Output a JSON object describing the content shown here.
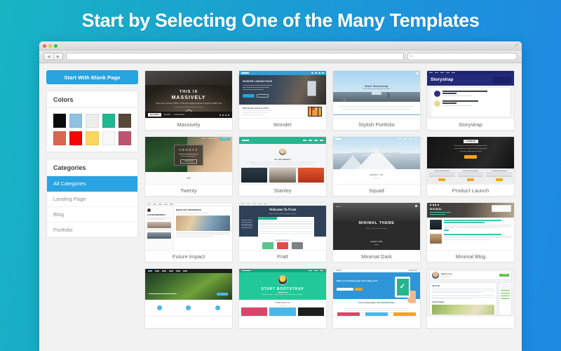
{
  "headline": "Start by Selecting One of the Many Templates",
  "browser": {
    "window_controls": [
      "close",
      "minimize",
      "maximize"
    ],
    "back_icon": "◀",
    "forward_icon": "▶",
    "address_value": "",
    "address_placeholder": "",
    "search_icon": "search-icon",
    "search_value": "",
    "expand_icon": "⤢"
  },
  "sidebar": {
    "blank_page_button": "Start With Blank Page",
    "colors_panel": {
      "title": "Colors",
      "rows": [
        [
          "#0a0a0a",
          "#8fc2e0",
          "#eceded",
          "#20b98f",
          "#574736"
        ],
        [
          "#d9674d",
          "#f60505",
          "#fbd75f",
          "#f8f8f8",
          "#bf5471"
        ]
      ]
    },
    "categories_panel": {
      "title": "Categories",
      "items": [
        {
          "label": "All Categories",
          "active": true
        },
        {
          "label": "Landing Page",
          "active": false
        },
        {
          "label": "Blog",
          "active": false
        },
        {
          "label": "Portfolio",
          "active": false
        }
      ]
    }
  },
  "templates": {
    "row1": [
      {
        "name": "Massively",
        "hero_title_line1": "THIS IS",
        "hero_title_line2": "MASSIVELY"
      },
      {
        "name": "Wonder",
        "hero_title": "WONDER LANDING PAGE"
      },
      {
        "name": "Stylish Portfolio",
        "hero_title": "Start Bootstrap"
      },
      {
        "name": "Storystrap",
        "hero_title": "Storystrap"
      }
    ],
    "row2": [
      {
        "name": "Twenty",
        "hero_title": "TWENTY"
      },
      {
        "name": "Stanley",
        "hero_title": "Hi, I am Stanley!"
      },
      {
        "name": "Squad",
        "hero_title": "WELCOME TO SQUAD",
        "section": "ABOUT US"
      },
      {
        "name": "Product Launch",
        "hero_title": "LAUNCH"
      }
    ],
    "row3": [
      {
        "name": "Future Impact",
        "hero_title": "FUTURE IMPERFECT",
        "sub": "MAKE ANY DIFFERENCE"
      },
      {
        "name": "Pratt",
        "hero_title": "Welcome To Pratt",
        "sub": "Designed To Excel"
      },
      {
        "name": "Minimal Dark",
        "hero_title": "MINIMAL THEME",
        "sub": "Hello, I'm Carter, Web designer",
        "section": "ABOUT ME"
      },
      {
        "name": "Minimal Blog",
        "hero_title": "MINIMAL"
      }
    ],
    "row4": [
      {
        "name": "",
        "hero_title": ""
      },
      {
        "name": "",
        "hero_title": "START BOOTSTRAP",
        "section": "PORTFOLIO"
      },
      {
        "name": "",
        "hero_title": "Make your landing page look really good",
        "sub": "Your Landing Page Looks Wonderful Here"
      },
      {
        "name": "",
        "hero_title": "James Lee",
        "badge": "Contact"
      }
    ]
  },
  "colors": {
    "accent_blue": "#27a3e0",
    "bg_gradient_left": "#18b4c4",
    "bg_gradient_right": "#1e8ae2",
    "app_bg": "#f2f2f2",
    "card_bg": "#ffffff"
  }
}
